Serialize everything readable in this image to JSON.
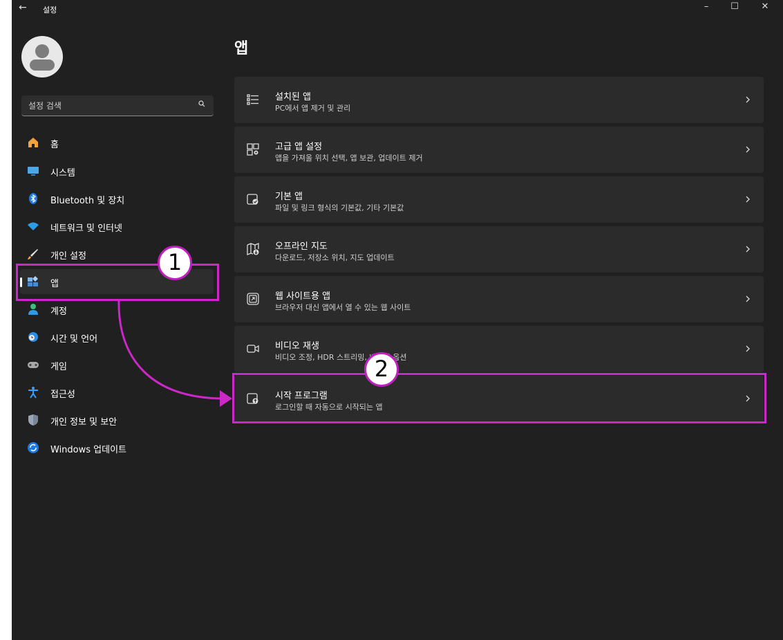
{
  "window": {
    "title": "설정",
    "back_icon": "back-arrow-icon",
    "controls": {
      "minimize": "–",
      "maximize": "☐",
      "close": "✕"
    }
  },
  "search": {
    "placeholder": "설정 검색"
  },
  "sidebar": {
    "items": [
      {
        "label": "홈",
        "icon": "home-icon"
      },
      {
        "label": "시스템",
        "icon": "monitor-icon"
      },
      {
        "label": "Bluetooth 및 장치",
        "icon": "bluetooth-icon"
      },
      {
        "label": "네트워크 및 인터넷",
        "icon": "wifi-icon"
      },
      {
        "label": "개인 설정",
        "icon": "brush-icon"
      },
      {
        "label": "앱",
        "icon": "apps-icon",
        "active": true
      },
      {
        "label": "계정",
        "icon": "account-icon"
      },
      {
        "label": "시간 및 언어",
        "icon": "globe-clock-icon"
      },
      {
        "label": "게임",
        "icon": "gamepad-icon"
      },
      {
        "label": "접근성",
        "icon": "accessibility-icon"
      },
      {
        "label": "개인 정보 및 보안",
        "icon": "shield-icon"
      },
      {
        "label": "Windows 업데이트",
        "icon": "update-icon"
      }
    ]
  },
  "main": {
    "title": "앱",
    "cards": [
      {
        "title": "설치된 앱",
        "subtitle": "PC에서 앱 제거 및 관리",
        "icon": "list-icon"
      },
      {
        "title": "고급 앱 설정",
        "subtitle": "앱을 가져올 위치 선택, 앱 보관, 업데이트 제거",
        "icon": "app-settings-icon"
      },
      {
        "title": "기본 앱",
        "subtitle": "파일 및 링크 형식의 기본값, 기타 기본값",
        "icon": "default-apps-icon"
      },
      {
        "title": "오프라인 지도",
        "subtitle": "다운로드, 저장소 위치, 지도 업데이트",
        "icon": "map-download-icon"
      },
      {
        "title": "웹 사이트용 앱",
        "subtitle": "브라우저 대신 앱에서 열 수 있는 웹 사이트",
        "icon": "open-external-icon"
      },
      {
        "title": "비디오 재생",
        "subtitle": "비디오 조정, HDR 스트리밍, 배터리 옵션",
        "icon": "video-icon"
      },
      {
        "title": "시작 프로그램",
        "subtitle": "로그인할 때 자동으로 시작되는 앱",
        "icon": "startup-icon"
      }
    ]
  },
  "annotations": {
    "step1": "1",
    "step2": "2",
    "color": "#cc28c8"
  }
}
